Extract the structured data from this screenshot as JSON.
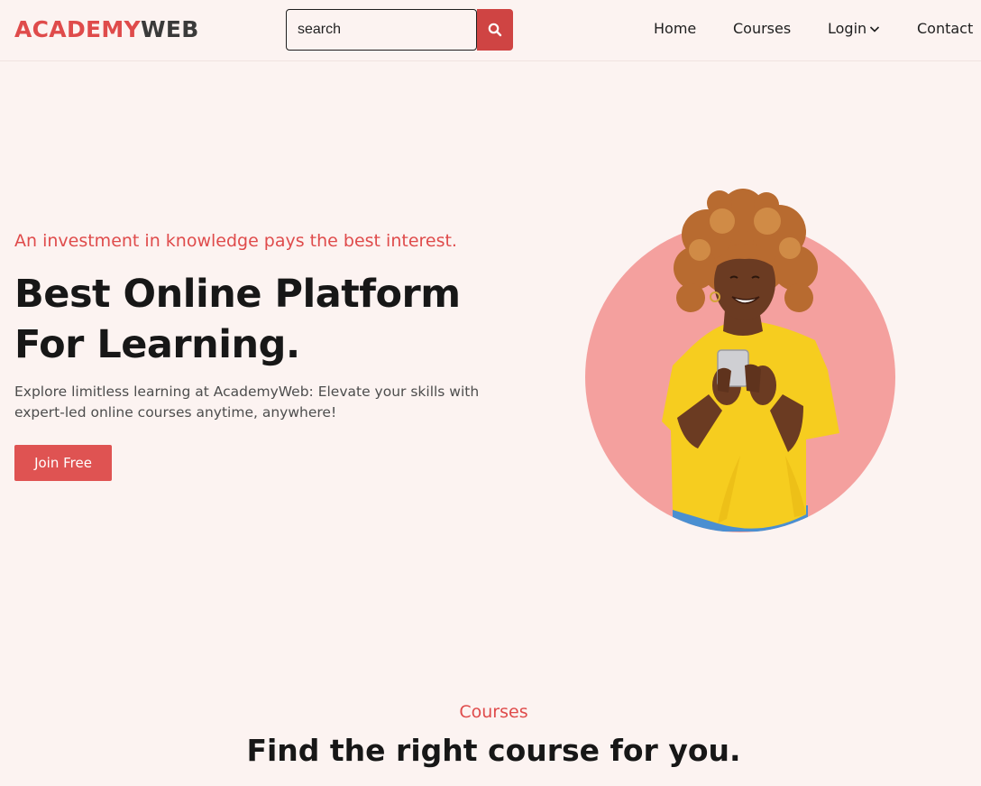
{
  "brand": {
    "part1": "ACADEMY",
    "part2": "WEB"
  },
  "search": {
    "placeholder": "search",
    "icon": "search-icon"
  },
  "nav": {
    "home": "Home",
    "courses": "Courses",
    "login": "Login",
    "contact": "Contact"
  },
  "hero": {
    "tagline": "An investment in knowledge pays the best interest.",
    "title_line1": "Best Online Platform",
    "title_line2": "For Learning.",
    "description": "Explore limitless learning at AcademyWeb: Elevate your skills with expert-led online courses anytime, anywhere!",
    "cta": "Join Free"
  },
  "courses_section": {
    "label": "Courses",
    "title": "Find the right course for you."
  },
  "colors": {
    "accent": "#df4b4b",
    "background": "#fcf3f1",
    "circle": "#f4a09e",
    "shirt": "#f6cd1f"
  }
}
